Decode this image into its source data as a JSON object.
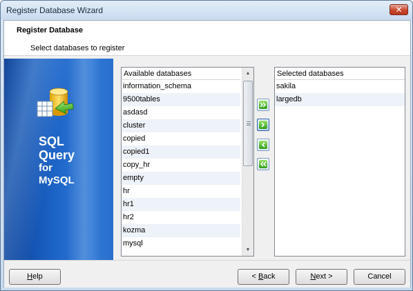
{
  "window": {
    "title": "Register Database Wizard",
    "close_glyph": "✕"
  },
  "header": {
    "title": "Register Database",
    "subtitle": "Select databases to register"
  },
  "banner": {
    "line1": "SQL",
    "line2": "Query",
    "line3": "for",
    "line4": "MySQL",
    "icon": "database-wizard-icon"
  },
  "available": {
    "header": "Available databases",
    "items": [
      "information_schema",
      "9500tables",
      "asdasd",
      "cluster",
      "copied",
      "copied1",
      "copy_hr",
      "empty",
      "hr",
      "hr1",
      "hr2",
      "kozma",
      "mysql"
    ]
  },
  "selected": {
    "header": "Selected databases",
    "items": [
      "sakila",
      "largedb"
    ]
  },
  "buttons": {
    "help": {
      "mnemonic": "H",
      "rest": "elp"
    },
    "back": {
      "prefix": "< ",
      "mnemonic": "B",
      "rest": "ack"
    },
    "next": {
      "mnemonic": "N",
      "rest": "ext >"
    },
    "cancel": "Cancel"
  },
  "colors": {
    "accent": "#1c63c6",
    "move_icon": "#3e9b23"
  }
}
